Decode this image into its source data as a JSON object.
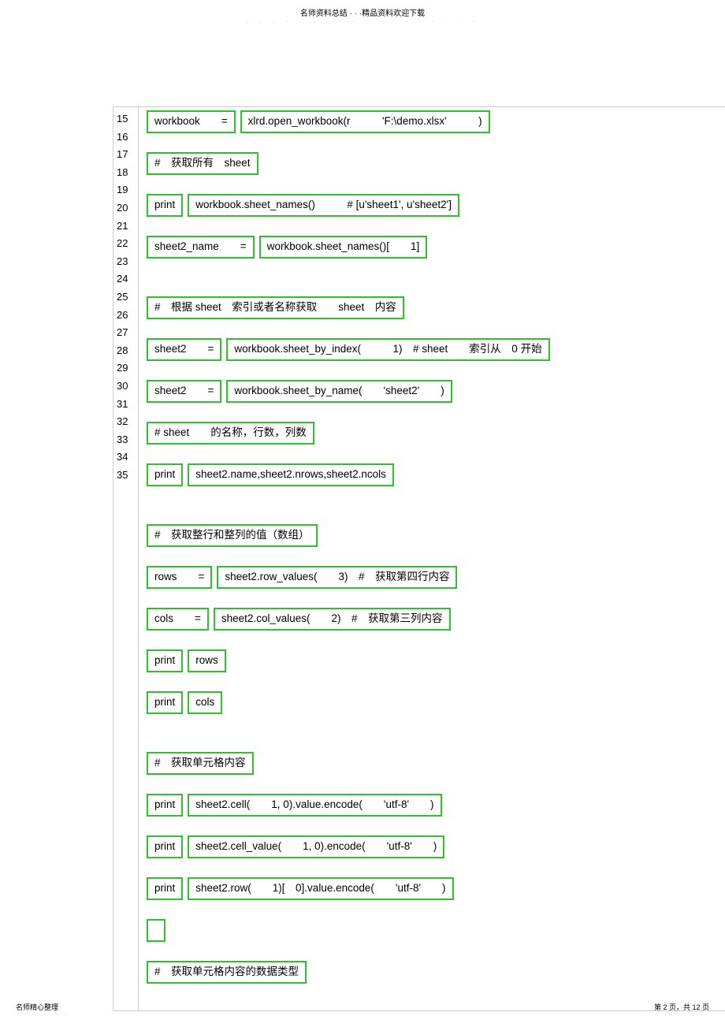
{
  "header": {
    "title": "名师资料总结 · · ·精品资料欢迎下载",
    "dots": "· · · · · · · · · · · · · · · · · ·"
  },
  "gutter": {
    "start": 15,
    "end": 35
  },
  "code": {
    "lines": [
      [
        {
          "t": "workbook  ="
        },
        {
          "t": "xlrd.open_workbook(r   'F:\\demo.xlsx'   )"
        }
      ],
      [
        {
          "t": "# 获取所有 sheet"
        }
      ],
      [
        {
          "t": "print"
        },
        {
          "t": "workbook.sheet_names()   # [u'sheet1', u'sheet2']"
        }
      ],
      [
        {
          "t": "sheet2_name  ="
        },
        {
          "t": "workbook.sheet_names()[  1]"
        }
      ],
      [
        {
          "t": "# 根据 sheet 索引或者名称获取  sheet 内容"
        }
      ],
      [
        {
          "t": "sheet2  ="
        },
        {
          "t": "workbook.sheet_by_index(   1) # sheet  索引从 0 开始"
        }
      ],
      [
        {
          "t": "sheet2  ="
        },
        {
          "t": "workbook.sheet_by_name(  'sheet2'  )"
        }
      ],
      [
        {
          "t": "# sheet  的名称，行数，列数"
        }
      ],
      [
        {
          "t": "print"
        },
        {
          "t": "sheet2.name,sheet2.nrows,sheet2.ncols"
        }
      ],
      [
        {
          "t": "# 获取整行和整列的值（数组）"
        }
      ],
      [
        {
          "t": "rows  ="
        },
        {
          "t": "sheet2.row_values(  3) # 获取第四行内容"
        }
      ],
      [
        {
          "t": "cols  ="
        },
        {
          "t": "sheet2.col_values(  2) # 获取第三列内容"
        }
      ],
      [
        {
          "t": "print"
        },
        {
          "t": "rows"
        }
      ],
      [
        {
          "t": "print"
        },
        {
          "t": "cols"
        }
      ],
      [
        {
          "t": "# 获取单元格内容"
        }
      ],
      [
        {
          "t": "print"
        },
        {
          "t": "sheet2.cell(  1, 0).value.encode(  'utf-8'  )"
        }
      ],
      [
        {
          "t": "print"
        },
        {
          "t": "sheet2.cell_value(  1, 0).encode(  'utf-8'  )"
        }
      ],
      [
        {
          "t": "print"
        },
        {
          "t": "sheet2.row(  1)[ 0].value.encode(  'utf-8'  )"
        }
      ],
      [
        {
          "t": "",
          "empty": true
        }
      ],
      [
        {
          "t": "# 获取单元格内容的数据类型"
        }
      ]
    ]
  },
  "footer": {
    "left": "名师精心整理",
    "left_dots": "· · · · · · ·",
    "right": "第 2 页，共 12 页",
    "right_dots": "· · · · · · · · ·"
  }
}
